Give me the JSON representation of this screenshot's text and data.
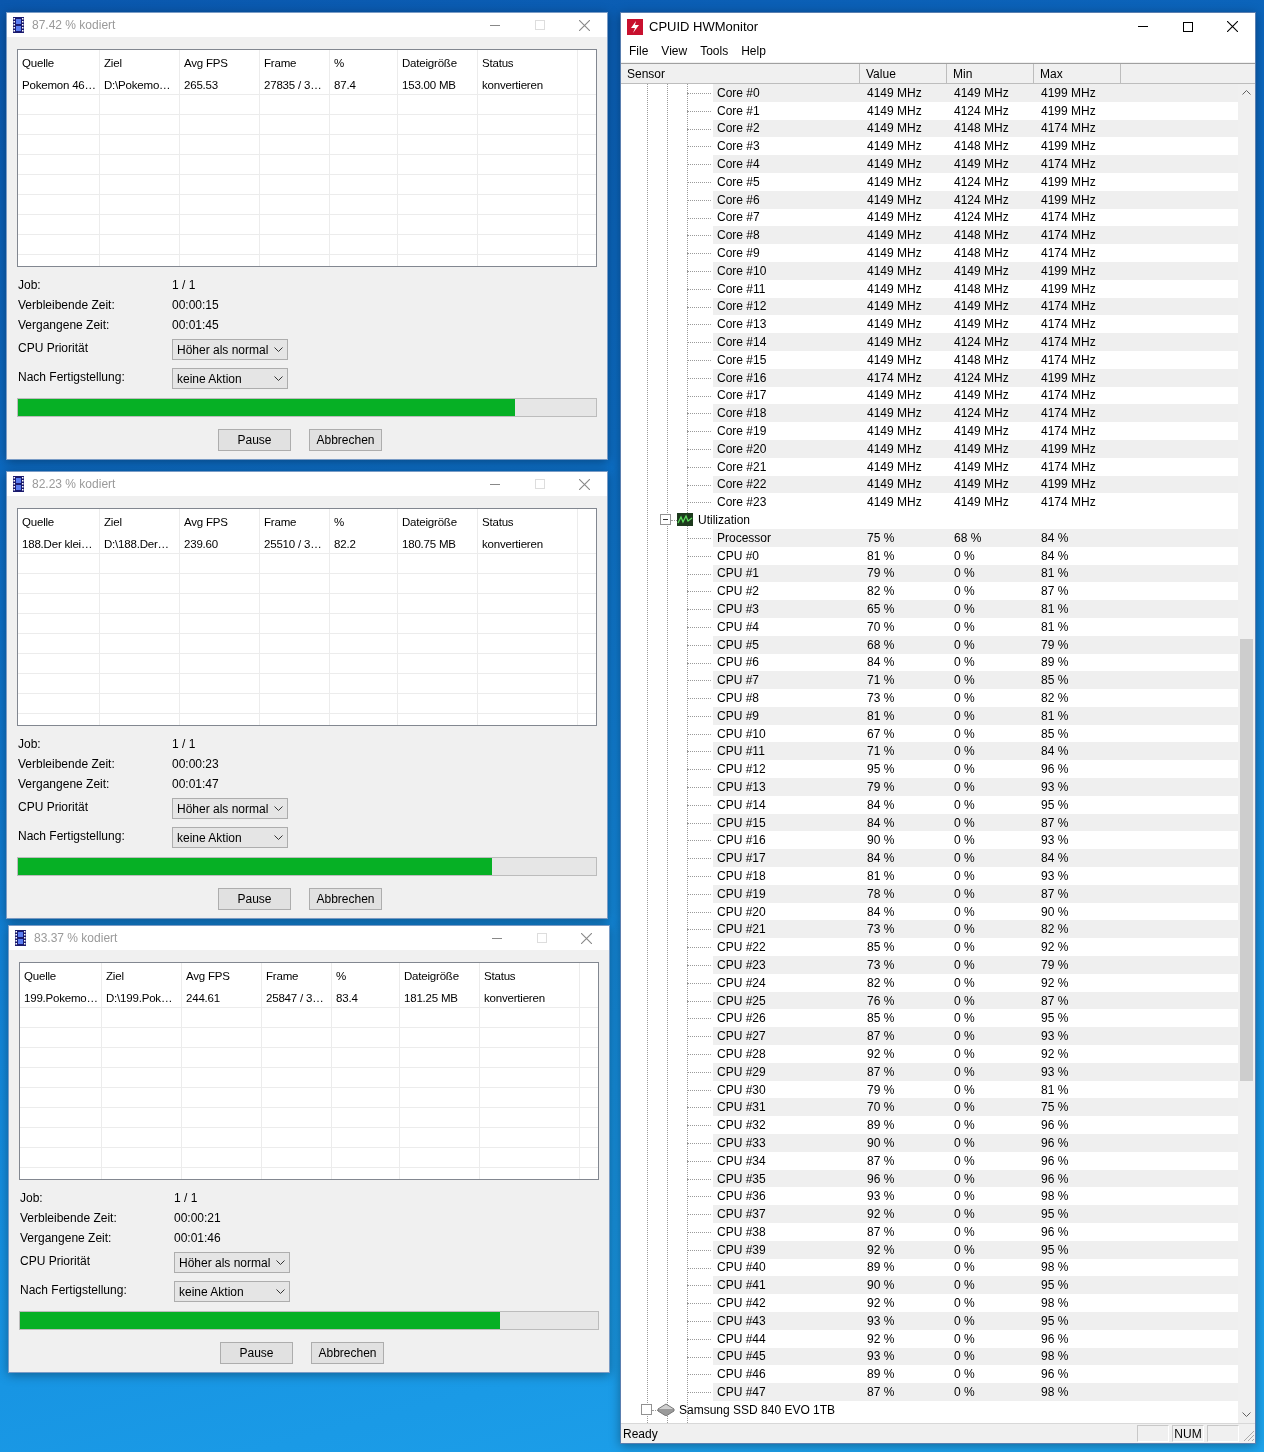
{
  "encoder_windows": [
    {
      "title": "87.42 % kodiert",
      "columns": [
        "Quelle",
        "Ziel",
        "Avg FPS",
        "Frame",
        "%",
        "Dateigröße",
        "Status"
      ],
      "rows": [
        {
          "cells": [
            "Pokemon 46…",
            "D:\\Pokemo…",
            "265.53",
            "27835 / 3…",
            "87.4",
            "153.00 MB",
            "konvertieren"
          ]
        }
      ],
      "info": [
        {
          "label": "Job:",
          "value": "1 / 1"
        },
        {
          "label": "Verbleibende Zeit:",
          "value": "00:00:15"
        },
        {
          "label": "Vergangene Zeit:",
          "value": "00:01:45"
        }
      ],
      "priority": {
        "label": "CPU Priorität",
        "value": "Höher als normal"
      },
      "after_completion": {
        "label": "Nach Fertigstellung:",
        "value": "keine Aktion"
      },
      "progress": {
        "level": 0.86
      },
      "buttons": [
        "Pause",
        "Abbrechen"
      ]
    },
    {
      "title": "82.23 % kodiert",
      "columns": [
        "Quelle",
        "Ziel",
        "Avg FPS",
        "Frame",
        "%",
        "Dateigröße",
        "Status"
      ],
      "rows": [
        {
          "cells": [
            "188.Der klei…",
            "D:\\188.Der…",
            "239.60",
            "25510 / 3…",
            "82.2",
            "180.75 MB",
            "konvertieren"
          ]
        }
      ],
      "info": [
        {
          "label": "Job:",
          "value": "1 / 1"
        },
        {
          "label": "Verbleibende Zeit:",
          "value": "00:00:23"
        },
        {
          "label": "Vergangene Zeit:",
          "value": "00:01:47"
        }
      ],
      "priority": {
        "label": "CPU Priorität",
        "value": "Höher als normal"
      },
      "after_completion": {
        "label": "Nach Fertigstellung:",
        "value": "keine Aktion"
      },
      "progress": {
        "level": 0.82
      },
      "buttons": [
        "Pause",
        "Abbrechen"
      ]
    },
    {
      "title": "83.37 % kodiert",
      "columns": [
        "Quelle",
        "Ziel",
        "Avg FPS",
        "Frame",
        "%",
        "Dateigröße",
        "Status"
      ],
      "rows": [
        {
          "cells": [
            "199.Pokemo…",
            "D:\\199.Pok…",
            "244.61",
            "25847 / 3…",
            "83.4",
            "181.25 MB",
            "konvertieren"
          ]
        }
      ],
      "info": [
        {
          "label": "Job:",
          "value": "1 / 1"
        },
        {
          "label": "Verbleibende Zeit:",
          "value": "00:00:21"
        },
        {
          "label": "Vergangene Zeit:",
          "value": "00:01:46"
        }
      ],
      "priority": {
        "label": "CPU Priorität",
        "value": "Höher als normal"
      },
      "after_completion": {
        "label": "Nach Fertigstellung:",
        "value": "keine Aktion"
      },
      "progress": {
        "level": 0.83
      },
      "buttons": [
        "Pause",
        "Abbrechen"
      ]
    }
  ],
  "hwmonitor": {
    "title": "CPUID HWMonitor",
    "menu": [
      "File",
      "View",
      "Tools",
      "Help"
    ],
    "columns": [
      "Sensor",
      "Value",
      "Min",
      "Max"
    ],
    "items": [
      {
        "kind": "sensor",
        "label": "Core #0",
        "value": "4149 MHz",
        "min": "4149 MHz",
        "max": "4199 MHz"
      },
      {
        "kind": "sensor",
        "label": "Core #1",
        "value": "4149 MHz",
        "min": "4124 MHz",
        "max": "4199 MHz"
      },
      {
        "kind": "sensor",
        "label": "Core #2",
        "value": "4149 MHz",
        "min": "4148 MHz",
        "max": "4174 MHz"
      },
      {
        "kind": "sensor",
        "label": "Core #3",
        "value": "4149 MHz",
        "min": "4148 MHz",
        "max": "4199 MHz"
      },
      {
        "kind": "sensor",
        "label": "Core #4",
        "value": "4149 MHz",
        "min": "4149 MHz",
        "max": "4174 MHz"
      },
      {
        "kind": "sensor",
        "label": "Core #5",
        "value": "4149 MHz",
        "min": "4124 MHz",
        "max": "4199 MHz"
      },
      {
        "kind": "sensor",
        "label": "Core #6",
        "value": "4149 MHz",
        "min": "4124 MHz",
        "max": "4199 MHz"
      },
      {
        "kind": "sensor",
        "label": "Core #7",
        "value": "4149 MHz",
        "min": "4124 MHz",
        "max": "4174 MHz"
      },
      {
        "kind": "sensor",
        "label": "Core #8",
        "value": "4149 MHz",
        "min": "4148 MHz",
        "max": "4174 MHz"
      },
      {
        "kind": "sensor",
        "label": "Core #9",
        "value": "4149 MHz",
        "min": "4148 MHz",
        "max": "4174 MHz"
      },
      {
        "kind": "sensor",
        "label": "Core #10",
        "value": "4149 MHz",
        "min": "4149 MHz",
        "max": "4199 MHz"
      },
      {
        "kind": "sensor",
        "label": "Core #11",
        "value": "4149 MHz",
        "min": "4148 MHz",
        "max": "4199 MHz"
      },
      {
        "kind": "sensor",
        "label": "Core #12",
        "value": "4149 MHz",
        "min": "4149 MHz",
        "max": "4174 MHz"
      },
      {
        "kind": "sensor",
        "label": "Core #13",
        "value": "4149 MHz",
        "min": "4149 MHz",
        "max": "4174 MHz"
      },
      {
        "kind": "sensor",
        "label": "Core #14",
        "value": "4149 MHz",
        "min": "4124 MHz",
        "max": "4174 MHz"
      },
      {
        "kind": "sensor",
        "label": "Core #15",
        "value": "4149 MHz",
        "min": "4148 MHz",
        "max": "4174 MHz"
      },
      {
        "kind": "sensor",
        "label": "Core #16",
        "value": "4174 MHz",
        "min": "4124 MHz",
        "max": "4199 MHz"
      },
      {
        "kind": "sensor",
        "label": "Core #17",
        "value": "4149 MHz",
        "min": "4149 MHz",
        "max": "4174 MHz"
      },
      {
        "kind": "sensor",
        "label": "Core #18",
        "value": "4149 MHz",
        "min": "4124 MHz",
        "max": "4174 MHz"
      },
      {
        "kind": "sensor",
        "label": "Core #19",
        "value": "4149 MHz",
        "min": "4149 MHz",
        "max": "4174 MHz"
      },
      {
        "kind": "sensor",
        "label": "Core #20",
        "value": "4149 MHz",
        "min": "4149 MHz",
        "max": "4199 MHz"
      },
      {
        "kind": "sensor",
        "label": "Core #21",
        "value": "4149 MHz",
        "min": "4149 MHz",
        "max": "4174 MHz"
      },
      {
        "kind": "sensor",
        "label": "Core #22",
        "value": "4149 MHz",
        "min": "4149 MHz",
        "max": "4199 MHz"
      },
      {
        "kind": "sensor",
        "label": "Core #23",
        "value": "4149 MHz",
        "min": "4149 MHz",
        "max": "4174 MHz"
      },
      {
        "kind": "group",
        "label": "Utilization",
        "expanded": true,
        "children": [
          {
            "kind": "sensor",
            "label": "Processor",
            "value": "75 %",
            "min": "68 %",
            "max": "84 %"
          },
          {
            "kind": "sensor",
            "label": "CPU #0",
            "value": "81 %",
            "min": "0 %",
            "max": "84 %"
          },
          {
            "kind": "sensor",
            "label": "CPU #1",
            "value": "79 %",
            "min": "0 %",
            "max": "81 %"
          },
          {
            "kind": "sensor",
            "label": "CPU #2",
            "value": "82 %",
            "min": "0 %",
            "max": "87 %"
          },
          {
            "kind": "sensor",
            "label": "CPU #3",
            "value": "65 %",
            "min": "0 %",
            "max": "81 %"
          },
          {
            "kind": "sensor",
            "label": "CPU #4",
            "value": "70 %",
            "min": "0 %",
            "max": "81 %"
          },
          {
            "kind": "sensor",
            "label": "CPU #5",
            "value": "68 %",
            "min": "0 %",
            "max": "79 %"
          },
          {
            "kind": "sensor",
            "label": "CPU #6",
            "value": "84 %",
            "min": "0 %",
            "max": "89 %"
          },
          {
            "kind": "sensor",
            "label": "CPU #7",
            "value": "71 %",
            "min": "0 %",
            "max": "85 %"
          },
          {
            "kind": "sensor",
            "label": "CPU #8",
            "value": "73 %",
            "min": "0 %",
            "max": "82 %"
          },
          {
            "kind": "sensor",
            "label": "CPU #9",
            "value": "81 %",
            "min": "0 %",
            "max": "81 %"
          },
          {
            "kind": "sensor",
            "label": "CPU #10",
            "value": "67 %",
            "min": "0 %",
            "max": "85 %"
          },
          {
            "kind": "sensor",
            "label": "CPU #11",
            "value": "71 %",
            "min": "0 %",
            "max": "84 %"
          },
          {
            "kind": "sensor",
            "label": "CPU #12",
            "value": "95 %",
            "min": "0 %",
            "max": "96 %"
          },
          {
            "kind": "sensor",
            "label": "CPU #13",
            "value": "79 %",
            "min": "0 %",
            "max": "93 %"
          },
          {
            "kind": "sensor",
            "label": "CPU #14",
            "value": "84 %",
            "min": "0 %",
            "max": "95 %"
          },
          {
            "kind": "sensor",
            "label": "CPU #15",
            "value": "84 %",
            "min": "0 %",
            "max": "87 %"
          },
          {
            "kind": "sensor",
            "label": "CPU #16",
            "value": "90 %",
            "min": "0 %",
            "max": "93 %"
          },
          {
            "kind": "sensor",
            "label": "CPU #17",
            "value": "84 %",
            "min": "0 %",
            "max": "84 %"
          },
          {
            "kind": "sensor",
            "label": "CPU #18",
            "value": "81 %",
            "min": "0 %",
            "max": "93 %"
          },
          {
            "kind": "sensor",
            "label": "CPU #19",
            "value": "78 %",
            "min": "0 %",
            "max": "87 %"
          },
          {
            "kind": "sensor",
            "label": "CPU #20",
            "value": "84 %",
            "min": "0 %",
            "max": "90 %"
          },
          {
            "kind": "sensor",
            "label": "CPU #21",
            "value": "73 %",
            "min": "0 %",
            "max": "82 %"
          },
          {
            "kind": "sensor",
            "label": "CPU #22",
            "value": "85 %",
            "min": "0 %",
            "max": "92 %"
          },
          {
            "kind": "sensor",
            "label": "CPU #23",
            "value": "73 %",
            "min": "0 %",
            "max": "79 %"
          },
          {
            "kind": "sensor",
            "label": "CPU #24",
            "value": "82 %",
            "min": "0 %",
            "max": "92 %"
          },
          {
            "kind": "sensor",
            "label": "CPU #25",
            "value": "76 %",
            "min": "0 %",
            "max": "87 %"
          },
          {
            "kind": "sensor",
            "label": "CPU #26",
            "value": "85 %",
            "min": "0 %",
            "max": "95 %"
          },
          {
            "kind": "sensor",
            "label": "CPU #27",
            "value": "87 %",
            "min": "0 %",
            "max": "93 %"
          },
          {
            "kind": "sensor",
            "label": "CPU #28",
            "value": "92 %",
            "min": "0 %",
            "max": "92 %"
          },
          {
            "kind": "sensor",
            "label": "CPU #29",
            "value": "87 %",
            "min": "0 %",
            "max": "93 %"
          },
          {
            "kind": "sensor",
            "label": "CPU #30",
            "value": "79 %",
            "min": "0 %",
            "max": "81 %"
          },
          {
            "kind": "sensor",
            "label": "CPU #31",
            "value": "70 %",
            "min": "0 %",
            "max": "75 %"
          },
          {
            "kind": "sensor",
            "label": "CPU #32",
            "value": "89 %",
            "min": "0 %",
            "max": "96 %"
          },
          {
            "kind": "sensor",
            "label": "CPU #33",
            "value": "90 %",
            "min": "0 %",
            "max": "96 %"
          },
          {
            "kind": "sensor",
            "label": "CPU #34",
            "value": "87 %",
            "min": "0 %",
            "max": "96 %"
          },
          {
            "kind": "sensor",
            "label": "CPU #35",
            "value": "96 %",
            "min": "0 %",
            "max": "96 %"
          },
          {
            "kind": "sensor",
            "label": "CPU #36",
            "value": "93 %",
            "min": "0 %",
            "max": "98 %"
          },
          {
            "kind": "sensor",
            "label": "CPU #37",
            "value": "92 %",
            "min": "0 %",
            "max": "95 %"
          },
          {
            "kind": "sensor",
            "label": "CPU #38",
            "value": "87 %",
            "min": "0 %",
            "max": "96 %"
          },
          {
            "kind": "sensor",
            "label": "CPU #39",
            "value": "92 %",
            "min": "0 %",
            "max": "95 %"
          },
          {
            "kind": "sensor",
            "label": "CPU #40",
            "value": "89 %",
            "min": "0 %",
            "max": "98 %"
          },
          {
            "kind": "sensor",
            "label": "CPU #41",
            "value": "90 %",
            "min": "0 %",
            "max": "95 %"
          },
          {
            "kind": "sensor",
            "label": "CPU #42",
            "value": "92 %",
            "min": "0 %",
            "max": "98 %"
          },
          {
            "kind": "sensor",
            "label": "CPU #43",
            "value": "93 %",
            "min": "0 %",
            "max": "95 %"
          },
          {
            "kind": "sensor",
            "label": "CPU #44",
            "value": "92 %",
            "min": "0 %",
            "max": "96 %"
          },
          {
            "kind": "sensor",
            "label": "CPU #45",
            "value": "93 %",
            "min": "0 %",
            "max": "98 %"
          },
          {
            "kind": "sensor",
            "label": "CPU #46",
            "value": "89 %",
            "min": "0 %",
            "max": "96 %"
          },
          {
            "kind": "sensor",
            "label": "CPU #47",
            "value": "87 %",
            "min": "0 %",
            "max": "98 %"
          }
        ]
      },
      {
        "kind": "device",
        "label": "Samsung SSD 840 EVO 1TB"
      }
    ],
    "status_bar": {
      "text": "Ready",
      "panels": [
        "NUM"
      ]
    }
  }
}
